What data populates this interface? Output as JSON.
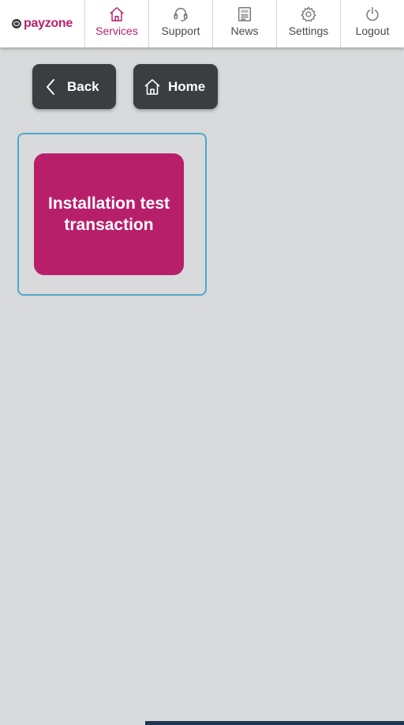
{
  "brand": {
    "name": "payzone",
    "color": "#b81f6b"
  },
  "nav": [
    {
      "label": "Services",
      "icon": "home-icon",
      "active": true
    },
    {
      "label": "Support",
      "icon": "headset-icon",
      "active": false
    },
    {
      "label": "News",
      "icon": "newspaper-icon",
      "active": false
    },
    {
      "label": "Settings",
      "icon": "gear-icon",
      "active": false
    },
    {
      "label": "Logout",
      "icon": "power-icon",
      "active": false
    }
  ],
  "actions": {
    "back_label": "Back",
    "home_label": "Home"
  },
  "tiles": [
    {
      "label": "Installation test transaction",
      "color": "#b81f6b"
    }
  ],
  "colors": {
    "background": "#d9dadb",
    "button_dark": "#3b3d40",
    "selection_border": "#4ea8c8"
  }
}
